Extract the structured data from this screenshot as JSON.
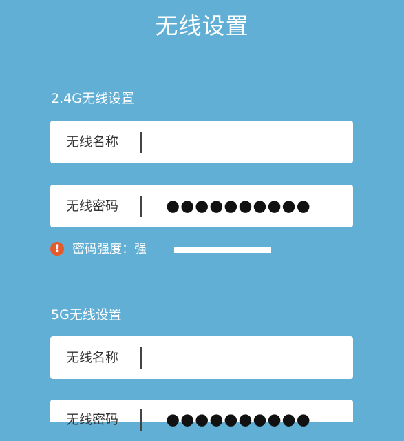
{
  "page": {
    "title": "无线设置"
  },
  "band_24g": {
    "section_title": "2.4G无线设置",
    "name_label": "无线名称",
    "name_value": "",
    "password_label": "无线密码",
    "password_mask": "●●●●●●●●●●",
    "strength_label": "密码强度：强",
    "strength_level": 1.0,
    "warning_icon": "exclamation-circle-icon"
  },
  "band_5g": {
    "section_title": "5G无线设置",
    "name_label": "无线名称",
    "name_value": "",
    "password_label": "无线密码",
    "password_mask": "●●●●●●●●●●"
  },
  "colors": {
    "background": "#62afd6",
    "field_background": "#ffffff",
    "warning": "#e35b2d"
  }
}
